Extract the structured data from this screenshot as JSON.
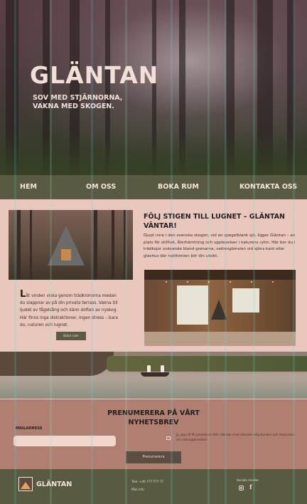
{
  "hero": {
    "title": "GLÄNTAN",
    "tagline": "SOV MED STJÄRNORNA,\nVAKNA MED SKOGEN."
  },
  "nav": {
    "items": [
      "HEM",
      "OM OSS",
      "BOKA RUM",
      "KONTAKTA OSS"
    ]
  },
  "section_one": {
    "heading": "FÖLJ STIGEN TILL LUGNET – GLÄNTAN VÄNTAR!",
    "body": "Djupt inne i den svenska skogen, vid en spegelblank sjö, ligger Gläntan – en plats för stillhet, återhämtning och upplevelser i naturens rytm. Här bor du i trädkojor svävande bland grenarna, vattengömslen vid sjöns kant eller glashus där natthimlen blir din utsikt.",
    "secondary_dropcap": "L",
    "secondary_text": "åt vinden viska genom trädkronorna medan du slappnar av på din privata terrass. Vakna till ljudet av fågelsång och känn doften av nyskog. Här finns inga distraktioner, ingen stress – bara du, naturen och lugnet.",
    "book_button": "Boka rum"
  },
  "newsletter": {
    "heading": "PRENUMERERA PÅ VÅRT NYHETSBREV",
    "email_label": "MAILADRESS",
    "email_placeholder": "",
    "consent_text": "Ja, jag vill få nyhetsbrev från Gläntan med aktuella erbjudanden och inspiration om naturupplevelser.",
    "subscribe_button": "Prenumerera"
  },
  "footer": {
    "brand": "GLÄNTAN",
    "phone": "Tele: +46 777 777 77",
    "email": "Mail info",
    "social_label": "Sociala medier"
  },
  "colors": {
    "nav_bg": "#585b42",
    "page_bg": "#e9c7bd",
    "newsletter_bg": "#b07f71",
    "button_bg": "#5b5a44",
    "hero_text": "#f3dfd7"
  },
  "icons": [
    "logo-icon",
    "instagram-icon",
    "facebook-icon",
    "checkbox"
  ]
}
